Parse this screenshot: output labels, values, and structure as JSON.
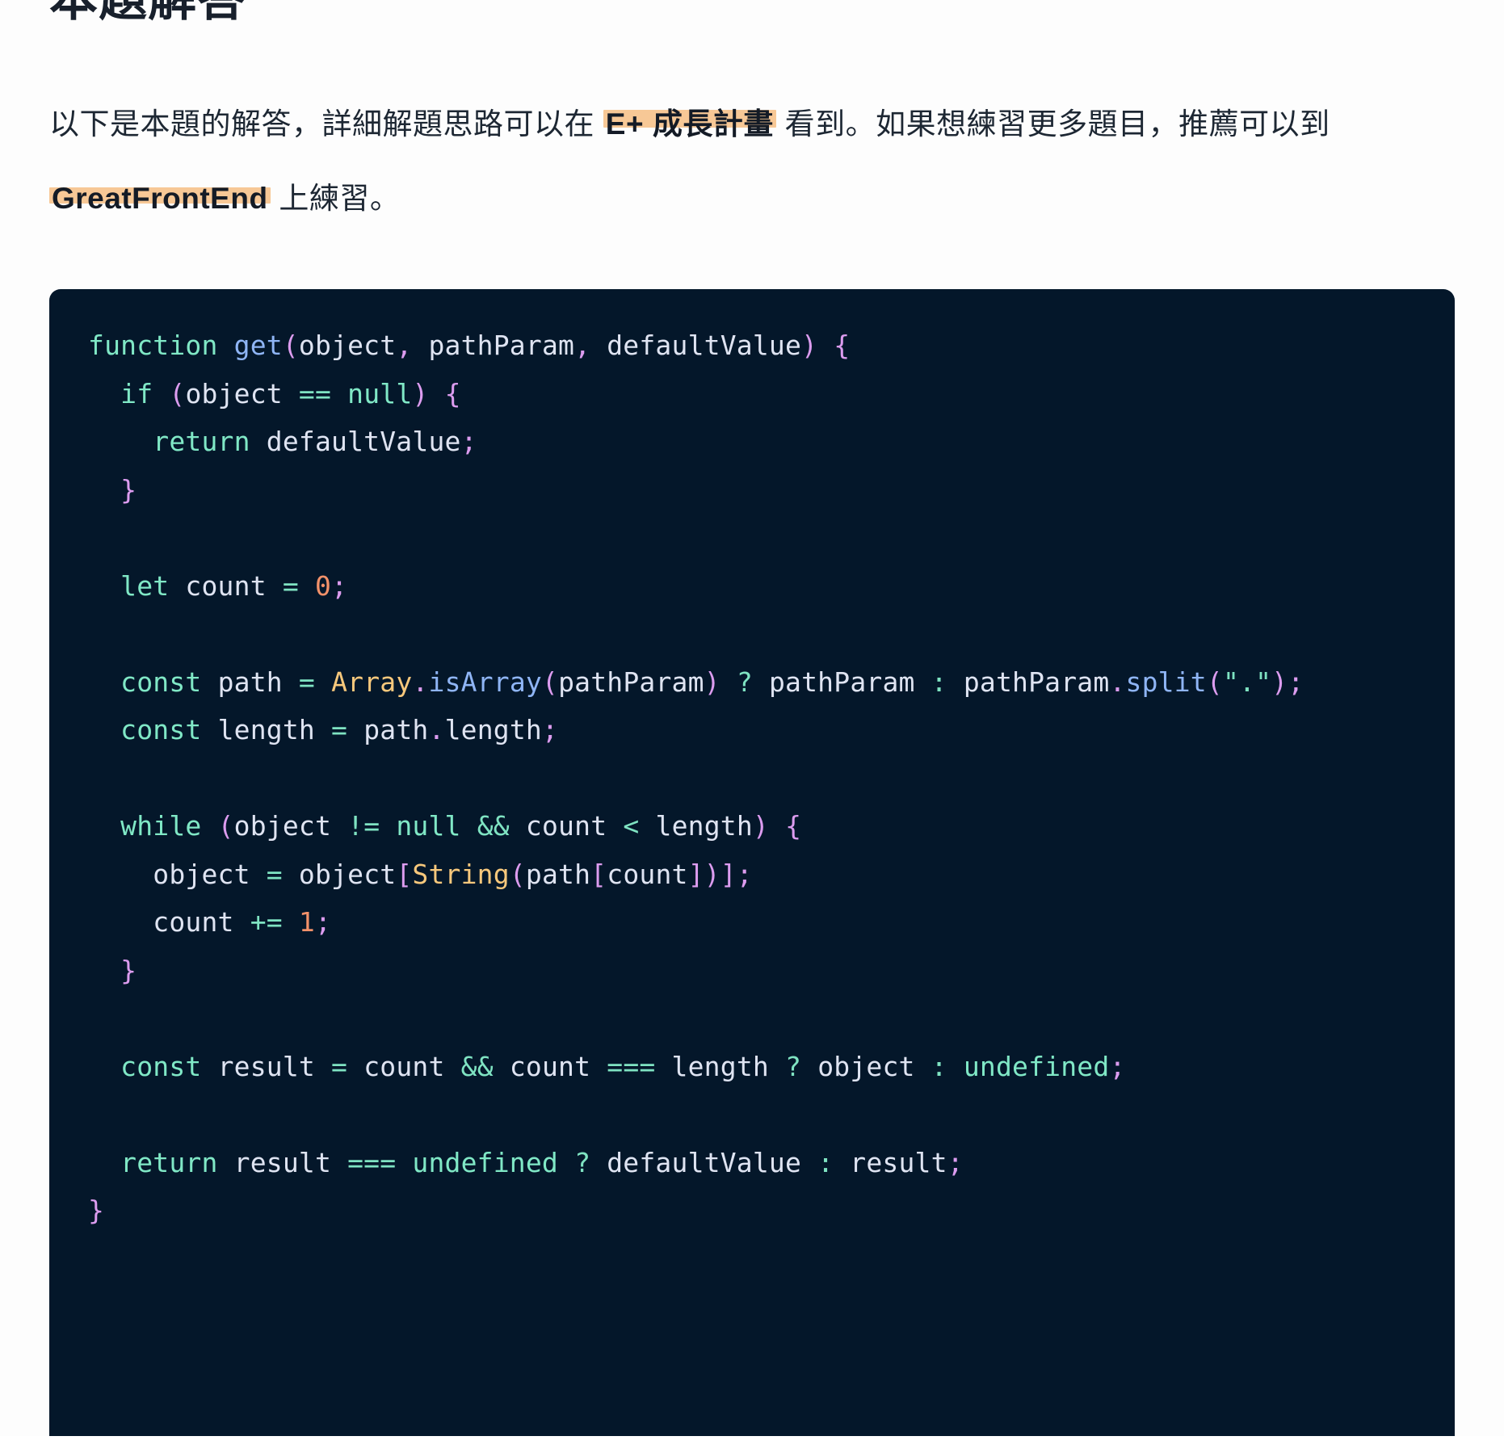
{
  "page": {
    "heading": "本題解答",
    "background_color": "#fdfdfd",
    "text_color": "#1d2733"
  },
  "intro": {
    "segment_1": "以下是本題的解答，詳細解題思路可以在 ",
    "link_1": "E+ 成長計畫",
    "segment_2": " 看到。如果想練習更多題目，推薦可以到 ",
    "link_2": "GreatFrontEnd",
    "segment_3": " 上練習。",
    "highlight_color": "#f7c896"
  },
  "code_block": {
    "language": "javascript",
    "background_color": "#04172a",
    "theme_colors": {
      "keyword": "#80e8c6",
      "function": "#8fb5f5",
      "class": "#f7c87c",
      "number": "#f2916a",
      "punctuation": "#dc9cef",
      "operator": "#7fe3c2",
      "identifier": "#dfe4f2",
      "string": "#7fe3c2"
    },
    "lines": [
      "function get(object, pathParam, defaultValue) {",
      "  if (object == null) {",
      "    return defaultValue;",
      "  }",
      "",
      "  let count = 0;",
      "",
      "  const path = Array.isArray(pathParam) ? pathParam : pathParam.split(\".\");",
      "  const length = path.length;",
      "",
      "  while (object != null && count < length) {",
      "    object = object[String(path[count])];",
      "    count += 1;",
      "  }",
      "",
      "  const result = count && count === length ? object : undefined;",
      "",
      "  return result === undefined ? defaultValue : result;",
      "}"
    ],
    "plain_text": "function get(object, pathParam, defaultValue) {\n  if (object == null) {\n    return defaultValue;\n  }\n\n  let count = 0;\n\n  const path = Array.isArray(pathParam) ? pathParam : pathParam.split(\".\");\n  const length = path.length;\n\n  while (object != null && count < length) {\n    object = object[String(path[count])];\n    count += 1;\n  }\n\n  const result = count && count === length ? object : undefined;\n\n  return result === undefined ? defaultValue : result;\n}"
  }
}
